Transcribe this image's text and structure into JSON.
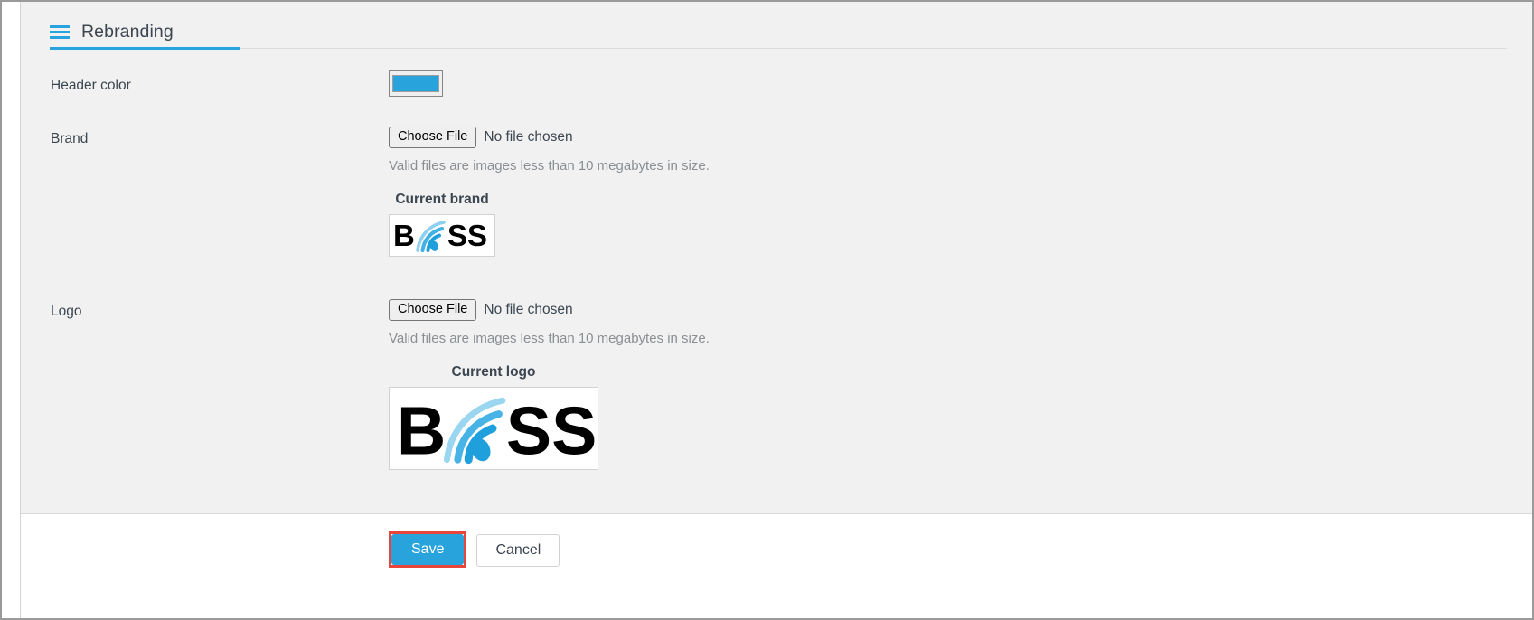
{
  "section": {
    "title": "Rebranding",
    "menu_icon": "hamburger-menu-icon",
    "accent_color": "#27a3dd"
  },
  "fields": {
    "header_color": {
      "label": "Header color",
      "value": "#29a3dc"
    },
    "brand": {
      "label": "Brand",
      "choose_file_label": "Choose File",
      "file_status": "No file chosen",
      "help_text": "Valid files are images less than 10 megabytes in size.",
      "current_caption": "Current brand",
      "current_image_alt": "BOSS"
    },
    "logo": {
      "label": "Logo",
      "choose_file_label": "Choose File",
      "file_status": "No file chosen",
      "help_text": "Valid files are images less than 10 megabytes in size.",
      "current_caption": "Current logo",
      "current_image_alt": "BOSS"
    }
  },
  "footer": {
    "save_label": "Save",
    "cancel_label": "Cancel",
    "save_highlight_color": "#e8453c",
    "save_button_color": "#29a3dc"
  },
  "brand_logo": {
    "text_before": "B",
    "text_after": "SS",
    "mark": "signal-waves-icon",
    "mark_color": "#29a3dc",
    "text_color": "#000000"
  }
}
